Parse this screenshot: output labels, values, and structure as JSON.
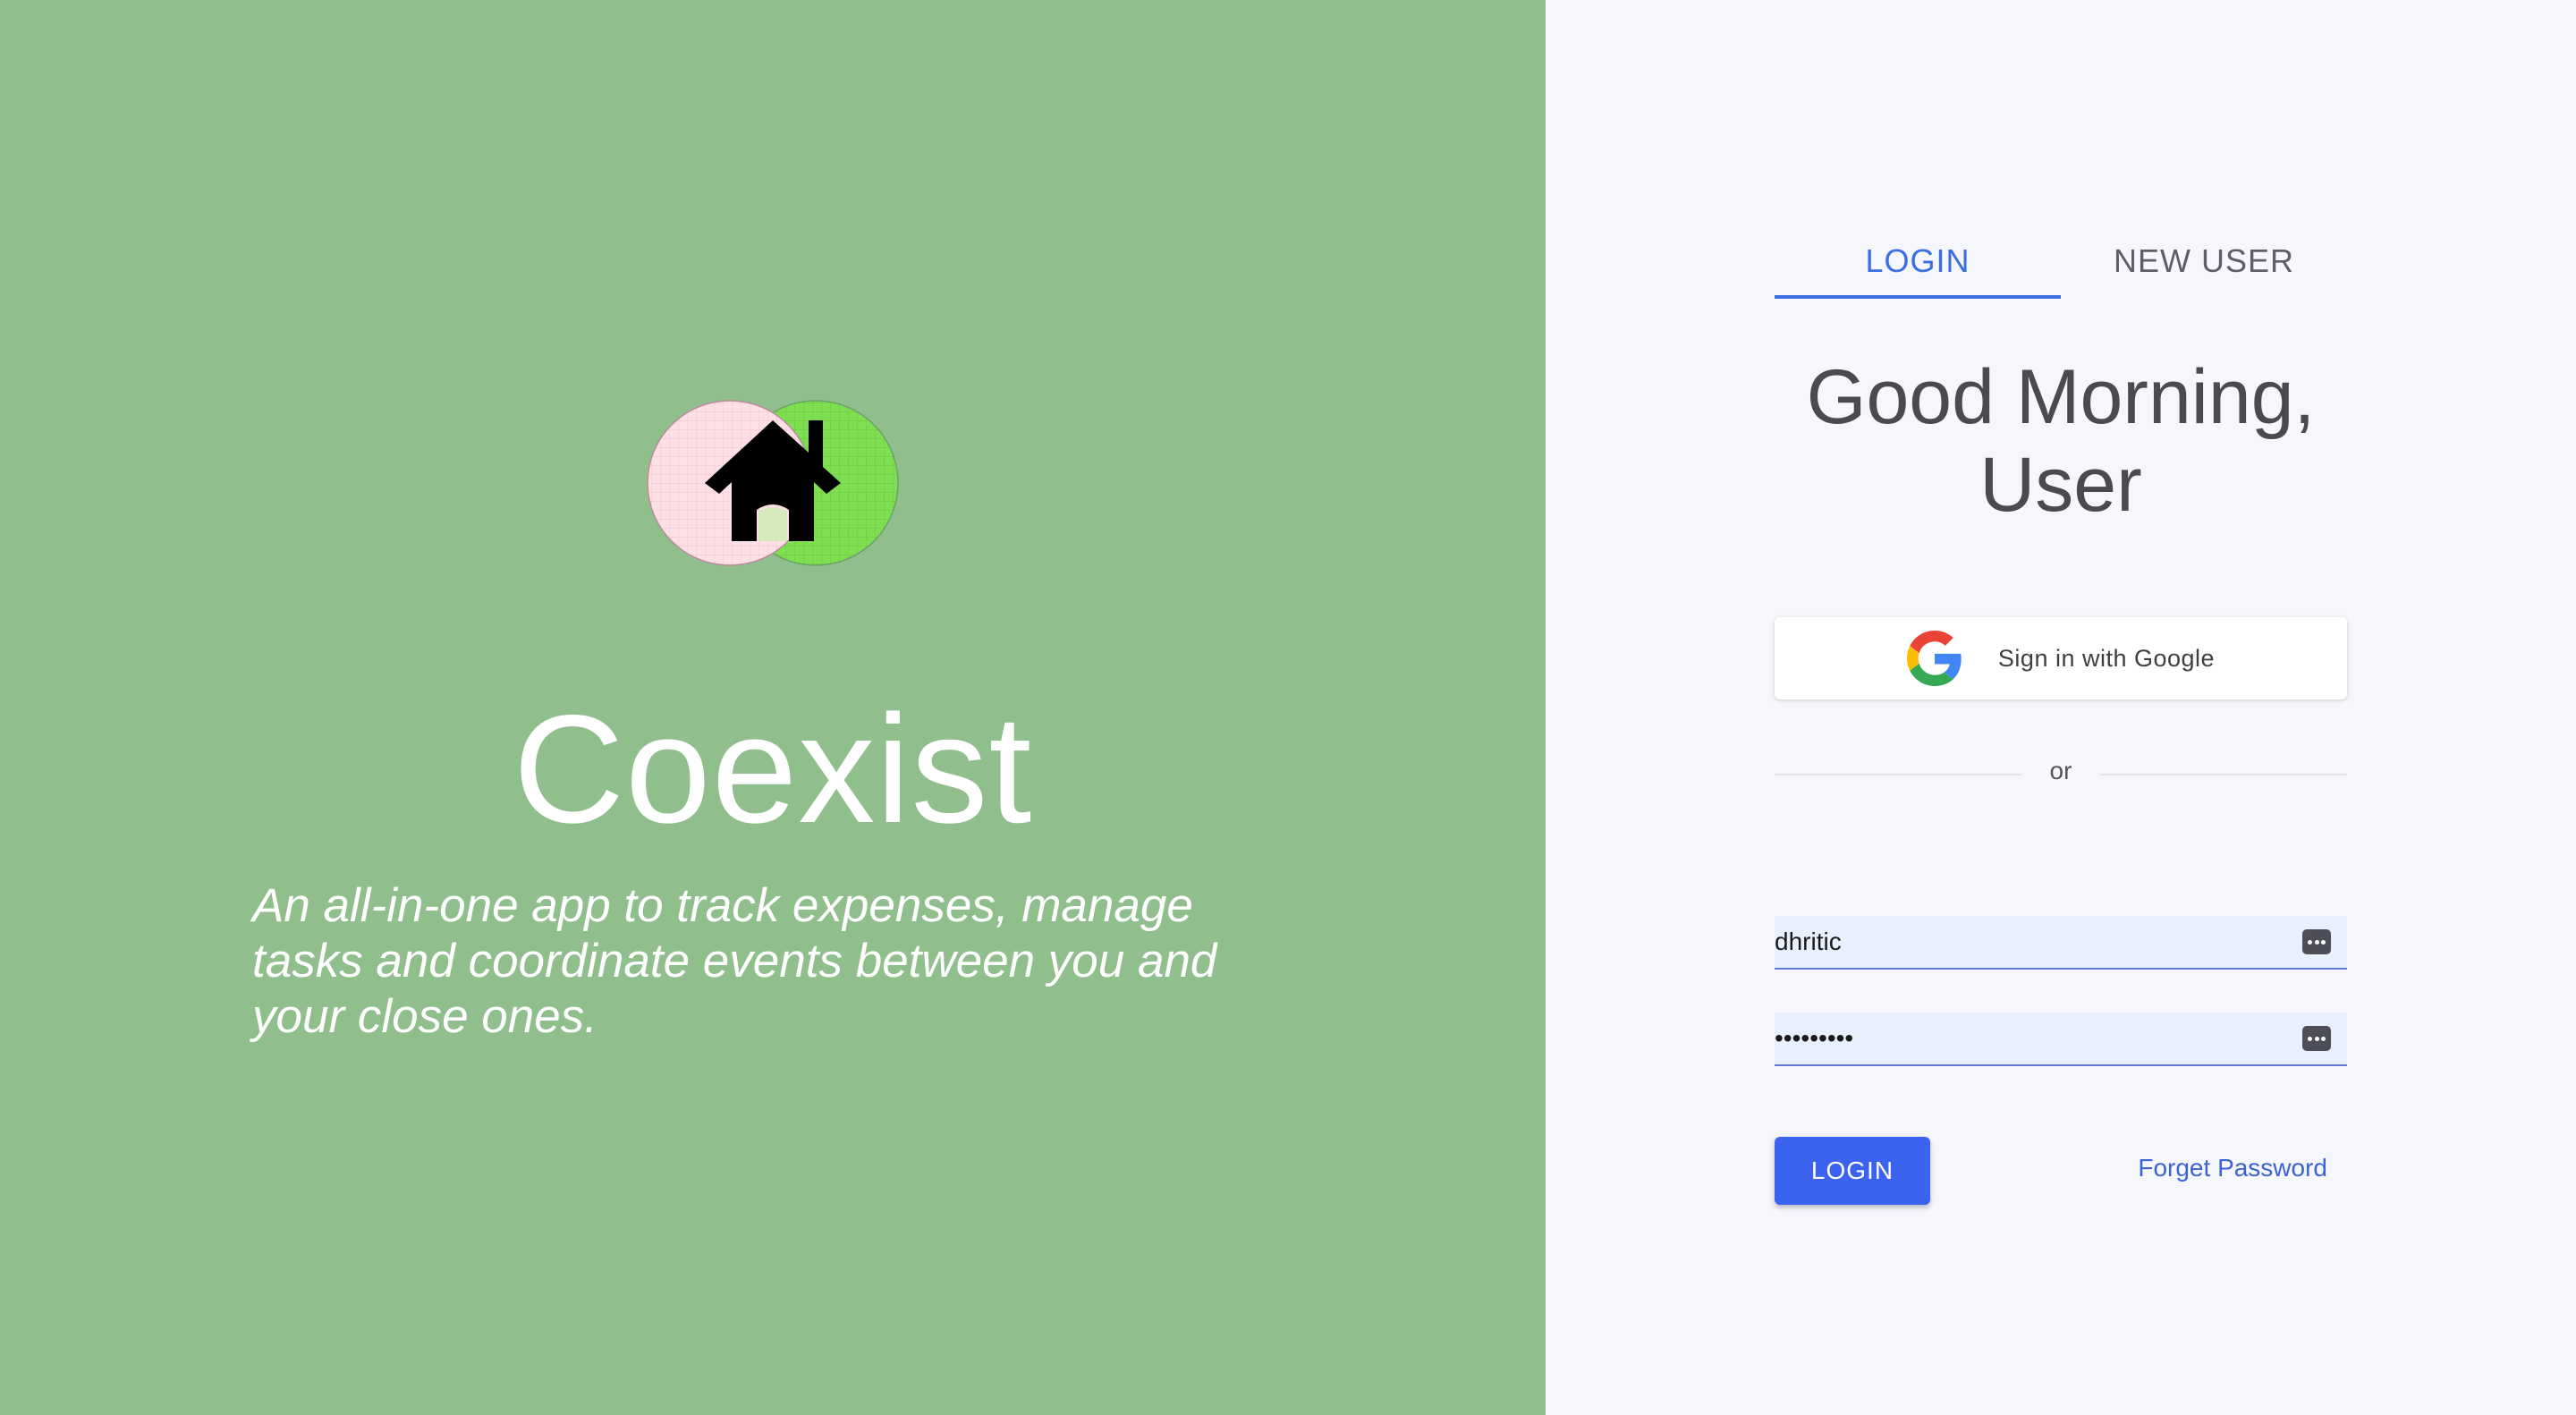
{
  "branding": {
    "app_name": "Coexist",
    "tagline": "An all-in-one app to track expenses, manage tasks and coordinate events between you and your close ones.",
    "logo_icon": "house-icon",
    "colors": {
      "left_panel": "#90be8d",
      "logo_circle_left": "#ffdfe6",
      "logo_circle_right": "#7ee051"
    }
  },
  "tabs": [
    {
      "label": "LOGIN",
      "active": true
    },
    {
      "label": "NEW USER",
      "active": false
    }
  ],
  "greeting": {
    "line1": "Good Morning,",
    "line2": "User"
  },
  "google": {
    "label": "Sign in with Google",
    "icon": "google-icon"
  },
  "divider": {
    "label": "or"
  },
  "form": {
    "username_value": "dhritic",
    "password_value": "•••••••••",
    "password_manager_icon": "password-manager-icon"
  },
  "actions": {
    "login_label": "LOGIN",
    "forgot_label": "Forget Password"
  },
  "colors": {
    "accent": "#3b6de3",
    "primary_button": "#3b63f0"
  }
}
